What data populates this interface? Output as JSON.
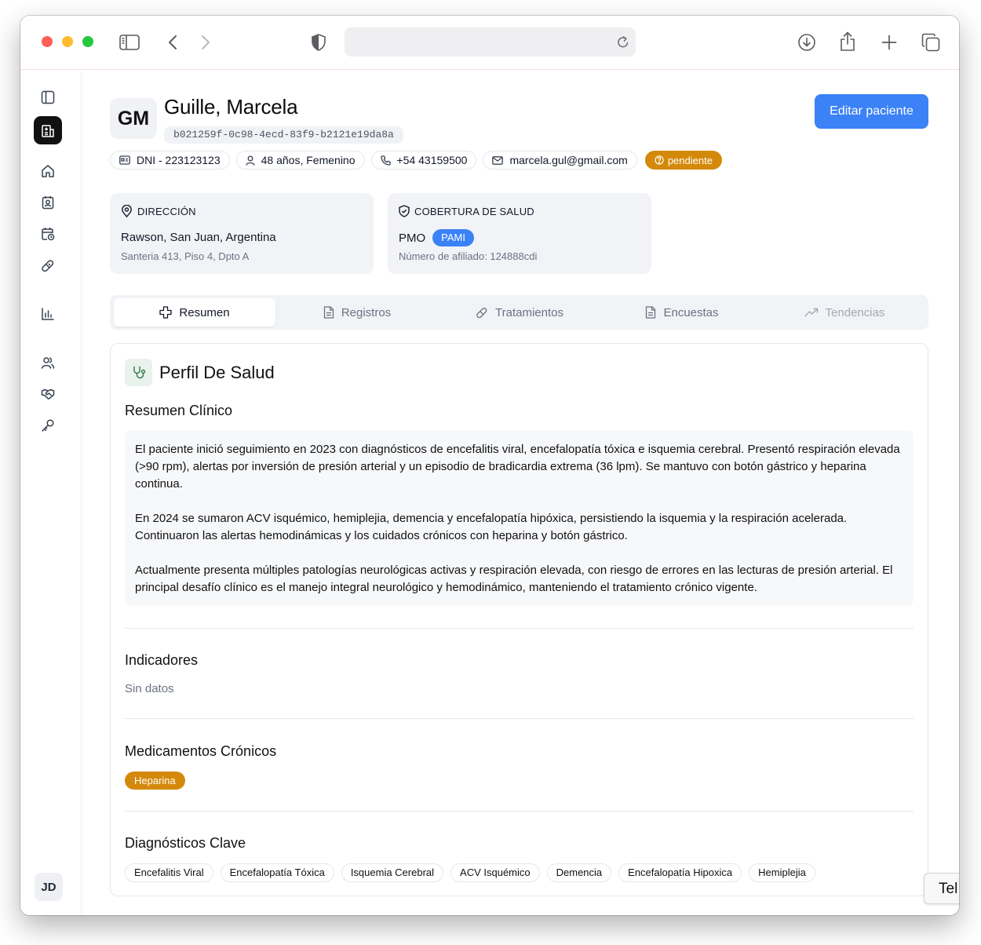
{
  "patient": {
    "initials": "GM",
    "name": "Guille, Marcela",
    "id": "b021259f-0c98-4ecd-83f9-b2121e19da8a",
    "dni": "DNI - 223123123",
    "age_sex": "48 años, Femenino",
    "phone": "+54 43159500",
    "email": "marcela.gul@gmail.com",
    "status": "pendiente"
  },
  "actions": {
    "edit_label": "Editar paciente"
  },
  "address": {
    "header": "DIRECCIÓN",
    "line1": "Rawson, San Juan, Argentina",
    "line2": "Santeria 413, Piso 4, Dpto A"
  },
  "coverage": {
    "header": "COBERTURA DE SALUD",
    "plan": "PMO",
    "provider": "PAMI",
    "affiliate": "Número de afiliado: 124888cdi"
  },
  "tabs": [
    {
      "label": "Resumen",
      "icon": "plus-cross-icon",
      "state": "active"
    },
    {
      "label": "Registros",
      "icon": "document-icon",
      "state": "normal"
    },
    {
      "label": "Tratamientos",
      "icon": "pill-icon",
      "state": "normal"
    },
    {
      "label": "Encuestas",
      "icon": "document-icon",
      "state": "normal"
    },
    {
      "label": "Tendencias",
      "icon": "trending-up-icon",
      "state": "disabled"
    }
  ],
  "profile": {
    "title": "Perfil De Salud",
    "summary_title": "Resumen Clínico",
    "summary": [
      "El paciente inició seguimiento en 2023 con diagnósticos de encefalitis viral, encefalopatía tóxica e isquemia cerebral. Presentó respiración elevada (>90 rpm), alertas por inversión de presión arterial y un episodio de bradicardia extrema (36 lpm). Se mantuvo con botón gástrico y heparina continua.",
      "En 2024 se sumaron ACV isquémico, hemiplejia, demencia y encefalopatía hipóxica, persistiendo la isquemia y la respiración acelerada. Continuaron las alertas hemodinámicas y los cuidados crónicos con heparina y botón gástrico.",
      "Actualmente presenta múltiples patologías neurológicas activas y respiración elevada, con riesgo de errores en las lecturas de presión arterial. El principal desafío clínico es el manejo integral neurológico y hemodinámico, manteniendo el tratamiento crónico vigente."
    ],
    "indicators_title": "Indicadores",
    "indicators_empty": "Sin datos",
    "meds_title": "Medicamentos Crónicos",
    "meds": [
      "Heparina"
    ],
    "diagnoses_title": "Diagnósticos Clave",
    "diagnoses": [
      "Encefalitis Viral",
      "Encefalopatía Tóxica",
      "Isquemia Cerebral",
      "ACV Isquémico",
      "Demencia",
      "Encefalopatía Hipoxica",
      "Hemiplejia"
    ]
  },
  "user": {
    "initials": "JD"
  },
  "floating": {
    "label": "Tel"
  },
  "colors": {
    "accent": "#3b82f6",
    "status": "#d4890a",
    "health_icon": "#2f7a4a"
  }
}
